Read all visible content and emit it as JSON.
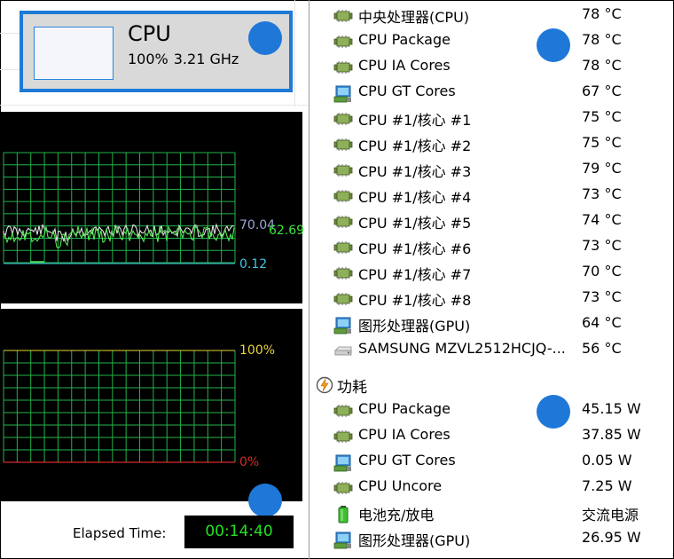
{
  "cpu_tile": {
    "title": "CPU",
    "usage": "100%",
    "frequency": "3.21 GHz"
  },
  "graph_top": {
    "label_high": "70.04",
    "label_low": "0.12",
    "label_current": "62.69",
    "colors": {
      "grid": "#22b34a",
      "line_white": "#e0e0e0",
      "line_green": "#55e655",
      "baseline": "#3fc6e8"
    }
  },
  "graph_bottom": {
    "label_top": "100%",
    "label_bottom": "0%",
    "colors": {
      "grid": "#22b34a",
      "top_label": "#e8d33a",
      "bottom_label": "#d32a2a",
      "baseline": "#d32a2a"
    }
  },
  "elapsed": {
    "label": "Elapsed Time:",
    "value": "00:14:40"
  },
  "temperatures": [
    {
      "icon": "chip-icon",
      "name": "中央处理器(CPU)",
      "value": "78 °C"
    },
    {
      "icon": "chip-icon",
      "name": "CPU Package",
      "value": "78 °C"
    },
    {
      "icon": "chip-icon",
      "name": "CPU IA Cores",
      "value": "78 °C"
    },
    {
      "icon": "gpu-icon",
      "name": "CPU GT Cores",
      "value": "67 °C"
    },
    {
      "icon": "chip-icon",
      "name": "CPU #1/核心 #1",
      "value": "75 °C"
    },
    {
      "icon": "chip-icon",
      "name": "CPU #1/核心 #2",
      "value": "75 °C"
    },
    {
      "icon": "chip-icon",
      "name": "CPU #1/核心 #3",
      "value": "79 °C"
    },
    {
      "icon": "chip-icon",
      "name": "CPU #1/核心 #4",
      "value": "73 °C"
    },
    {
      "icon": "chip-icon",
      "name": "CPU #1/核心 #5",
      "value": "74 °C"
    },
    {
      "icon": "chip-icon",
      "name": "CPU #1/核心 #6",
      "value": "73 °C"
    },
    {
      "icon": "chip-icon",
      "name": "CPU #1/核心 #7",
      "value": "70 °C"
    },
    {
      "icon": "chip-icon",
      "name": "CPU #1/核心 #8",
      "value": "73 °C"
    },
    {
      "icon": "gpu-icon",
      "name": "图形处理器(GPU)",
      "value": "64 °C"
    },
    {
      "icon": "disk-icon",
      "name": "SAMSUNG MZVL2512HCJQ-...",
      "value": "56 °C"
    }
  ],
  "power_section": {
    "icon": "power-icon",
    "title": "功耗"
  },
  "power": [
    {
      "icon": "chip-icon",
      "name": "CPU Package",
      "value": "45.15 W"
    },
    {
      "icon": "chip-icon",
      "name": "CPU IA Cores",
      "value": "37.85 W"
    },
    {
      "icon": "gpu-icon",
      "name": "CPU GT Cores",
      "value": "0.05 W"
    },
    {
      "icon": "chip-icon",
      "name": "CPU Uncore",
      "value": "7.25 W"
    },
    {
      "icon": "battery-icon",
      "name": "电池充/放电",
      "value": "交流电源"
    },
    {
      "icon": "gpu-icon",
      "name": "图形处理器(GPU)",
      "value": "26.95 W"
    }
  ]
}
